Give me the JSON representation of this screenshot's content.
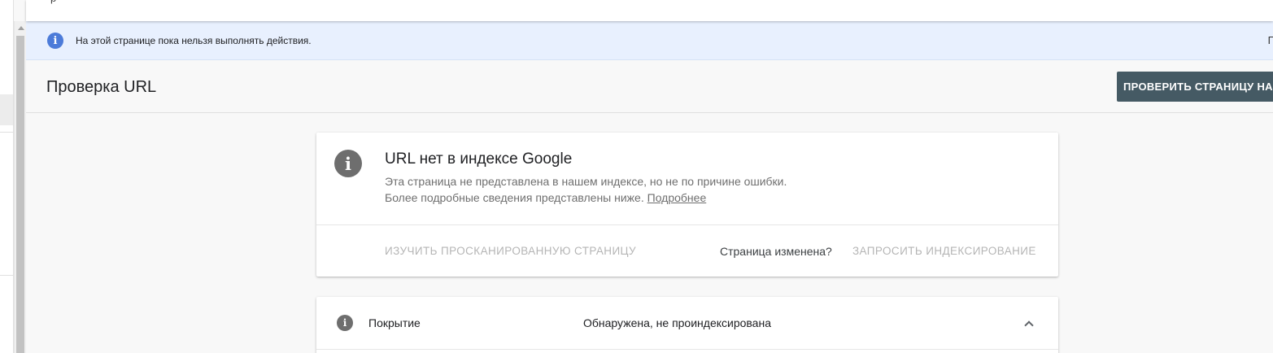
{
  "banner": {
    "icon": "info-icon",
    "text": "На этой странице пока нельзя выполнять действия.",
    "right_fragment": "П"
  },
  "header": {
    "title": "Проверка URL",
    "test_button_label": "ПРОВЕРИТЬ СТРАНИЦУ НА"
  },
  "status_card": {
    "icon": "info-icon",
    "title": "URL нет в индексе Google",
    "description_line1": "Эта страница не представлена в нашем индексе, но не по причине ошибки.",
    "description_line2": "Более подробные сведения представлены ниже.",
    "learn_more_label": "Подробнее",
    "view_crawled_label": "ИЗУЧИТЬ ПРОСКАНИРОВАННУЮ СТРАНИЦУ",
    "page_changed_text": "Страница изменена?",
    "request_indexing_label": "ЗАПРОСИТЬ ИНДЕКСИРОВАНИЕ"
  },
  "coverage": {
    "icon": "info-icon",
    "label": "Покрытие",
    "value": "Обнаружена, не проиндексирована",
    "expand_icon": "chevron-up-icon"
  },
  "colors": {
    "banner_bg": "#e8f0fe",
    "banner_icon": "#4c7bd9",
    "test_button_bg": "#455a64",
    "disabled_action": "#b5b5b5",
    "info_icon_gray": "#6e6e6e"
  }
}
